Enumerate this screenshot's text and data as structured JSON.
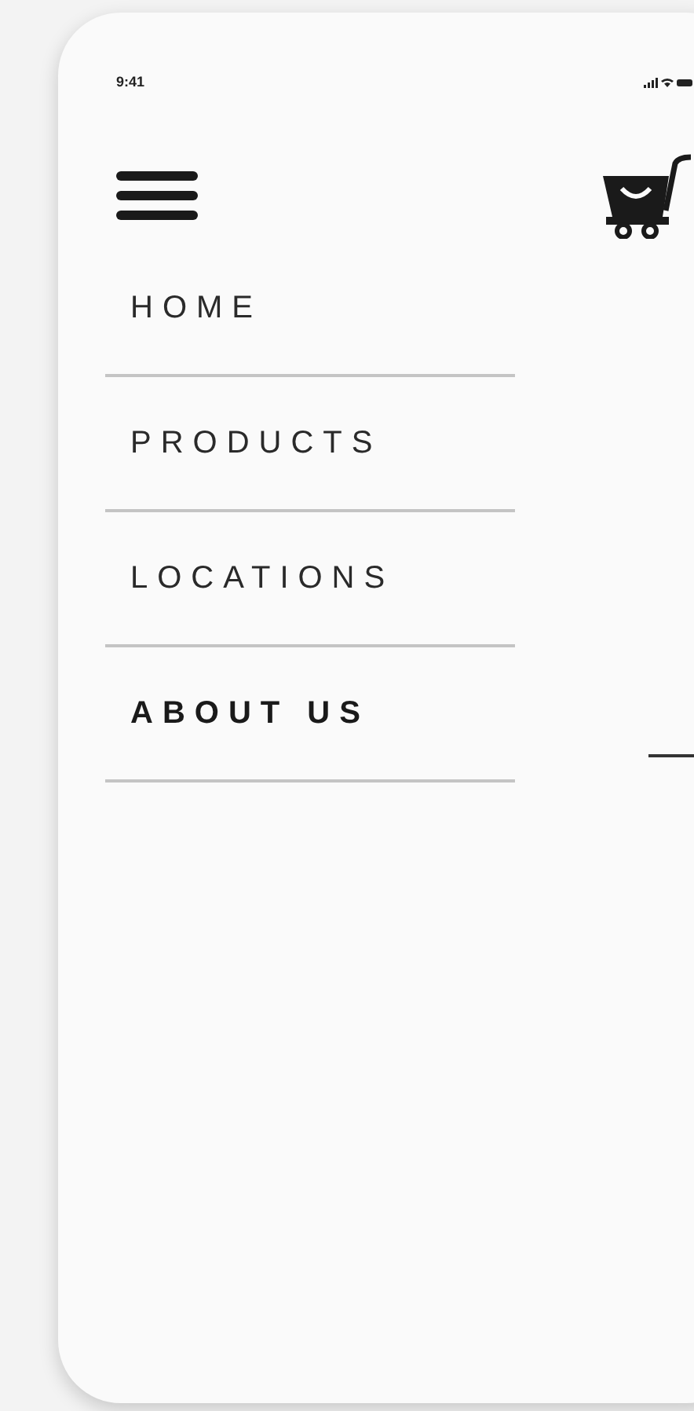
{
  "status_bar": {
    "time": "9:41"
  },
  "menu": [
    {
      "label": "HOME",
      "selected": false
    },
    {
      "label": "PRODUCTS",
      "selected": false
    },
    {
      "label": "LOCATIONS",
      "selected": false
    },
    {
      "label": "ABOUT US",
      "selected": true
    }
  ]
}
